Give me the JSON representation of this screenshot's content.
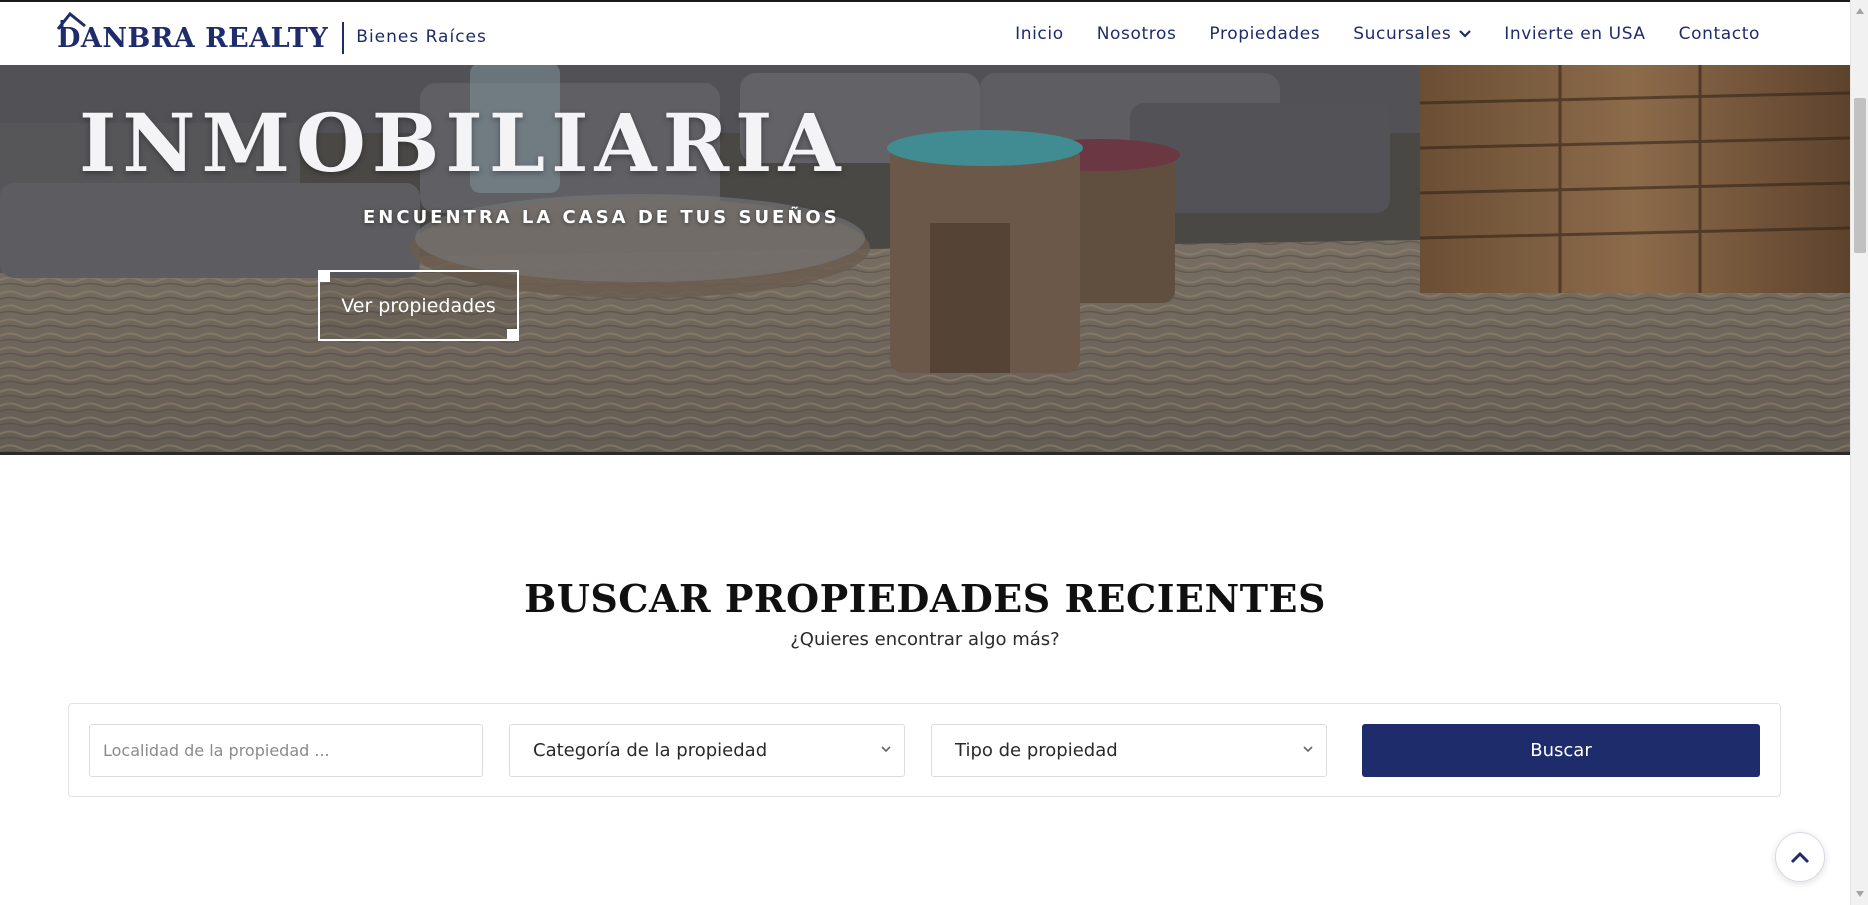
{
  "header": {
    "logo_text": "DANBRA REALTY",
    "logo_sub": "Bienes Raíces",
    "nav": [
      {
        "label": "Inicio"
      },
      {
        "label": "Nosotros"
      },
      {
        "label": "Propiedades"
      },
      {
        "label": "Sucursales",
        "has_dropdown": true
      },
      {
        "label": "Invierte en USA"
      },
      {
        "label": "Contacto"
      }
    ]
  },
  "hero": {
    "title": "INMOBILIARIA",
    "subtitle": "ENCUENTRA LA CASA DE TUS SUEÑOS",
    "button_label": "Ver propiedades"
  },
  "search": {
    "title": "BUSCAR PROPIEDADES RECIENTES",
    "subtitle": "¿Quieres encontrar algo más?",
    "location_placeholder": "Localidad de la propiedad ...",
    "category_selected": "Categoría de la propiedad",
    "type_selected": "Tipo de propiedad",
    "button_label": "Buscar"
  },
  "icons": {
    "scroll_top": "chevron-up-icon",
    "dropdown": "chevron-down-icon"
  },
  "colors": {
    "brand": "#1f2c6b",
    "button_bg": "#1f2c6b",
    "hero_text": "#ffffff"
  }
}
